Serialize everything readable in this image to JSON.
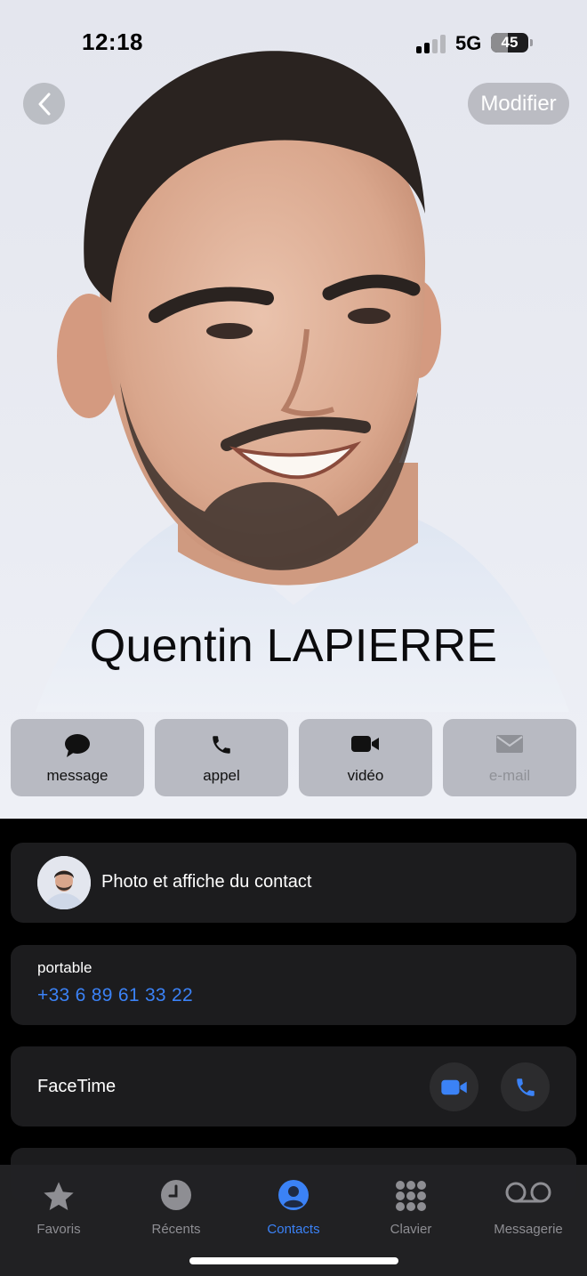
{
  "status_bar": {
    "time": "12:18",
    "network": "5G",
    "battery_percent": "45",
    "battery_level": 0.45,
    "signal_bars_active": 2,
    "signal_bars_total": 4
  },
  "header": {
    "back_icon": "chevron-left-icon",
    "edit_label": "Modifier"
  },
  "contact": {
    "name": "Quentin LAPIERRE"
  },
  "actions": [
    {
      "label": "message",
      "icon": "message-bubble-icon",
      "enabled": true
    },
    {
      "label": "appel",
      "icon": "phone-icon",
      "enabled": true
    },
    {
      "label": "vidéo",
      "icon": "video-camera-icon",
      "enabled": true
    },
    {
      "label": "e-mail",
      "icon": "envelope-icon",
      "enabled": false
    }
  ],
  "photo_card": {
    "label": "Photo et affiche du contact"
  },
  "phone": {
    "type": "portable",
    "number": "+33 6 89 61 33 22"
  },
  "facetime": {
    "label": "FaceTime",
    "video_icon": "video-camera-icon",
    "audio_icon": "phone-icon"
  },
  "tabbar": {
    "tabs": [
      {
        "label": "Favoris",
        "icon": "star-icon",
        "active": false
      },
      {
        "label": "Récents",
        "icon": "clock-icon",
        "active": false
      },
      {
        "label": "Contacts",
        "icon": "person-circle-icon",
        "active": true
      },
      {
        "label": "Clavier",
        "icon": "keypad-icon",
        "active": false
      },
      {
        "label": "Messagerie",
        "icon": "voicemail-icon",
        "active": false
      }
    ]
  },
  "colors": {
    "accent": "#3b82f6",
    "card_bg": "#1c1c1e",
    "page_bg": "#000000",
    "tab_inactive": "#8e8e93"
  }
}
